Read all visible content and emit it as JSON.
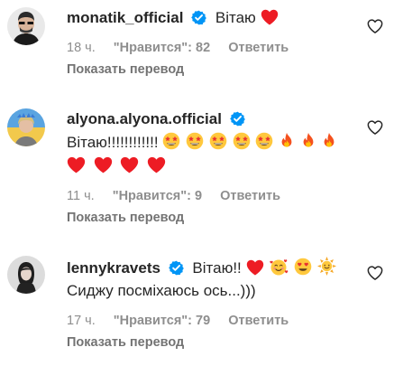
{
  "comments": [
    {
      "username": "monatik_official",
      "text": "Вітаю",
      "emoji_after": [
        "heart"
      ],
      "time": "18 ч.",
      "likes": "\"Нравится\": 82",
      "reply": "Ответить",
      "translate": "Показать перевод",
      "avatar": "man-sunglasses-avatar"
    },
    {
      "username": "alyona.alyona.official",
      "text": "Вітаю!!!!!!!!!!!!",
      "emoji_after": [
        "star-eyes",
        "star-eyes",
        "star-eyes",
        "star-eyes",
        "star-eyes",
        "fire",
        "fire",
        "fire"
      ],
      "emoji_line2": [
        "heart",
        "heart",
        "heart",
        "heart"
      ],
      "time": "11 ч.",
      "likes": "\"Нравится\": 9",
      "reply": "Ответить",
      "translate": "Показать перевод",
      "avatar": "woman-blue-yellow-avatar"
    },
    {
      "username": "lennykravets",
      "text": "Вітаю!!",
      "emoji_after": [
        "heart",
        "hearts-face",
        "heart-eyes",
        "sun"
      ],
      "text_line2": "Сиджу посміхаюсь ось...)))",
      "time": "17 ч.",
      "likes": "\"Нравится\": 79",
      "reply": "Ответить",
      "translate": "Показать перевод",
      "avatar": "woman-bw-avatar"
    }
  ],
  "colors": {
    "verified": "#0095f6",
    "heart": "#ed1c24",
    "emoji_yellow": "#ffc83d",
    "meta": "#8e8e8e",
    "text": "#262626"
  },
  "icons": {
    "verified": "verified-badge-icon",
    "like": "heart-outline-icon"
  }
}
